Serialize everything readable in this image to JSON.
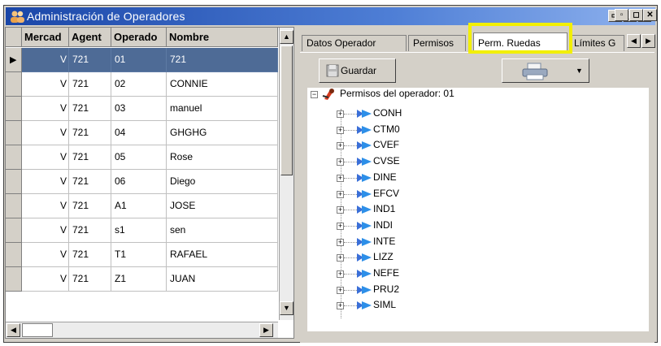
{
  "window": {
    "title": "Administración de Operadores"
  },
  "grid": {
    "columns": [
      "Mercad",
      "Agent",
      "Operado",
      "Nombre"
    ],
    "rows": [
      [
        "V",
        "721",
        "01",
        "721"
      ],
      [
        "V",
        "721",
        "02",
        "CONNIE"
      ],
      [
        "V",
        "721",
        "03",
        "manuel"
      ],
      [
        "V",
        "721",
        "04",
        "GHGHG"
      ],
      [
        "V",
        "721",
        "05",
        "Rose"
      ],
      [
        "V",
        "721",
        "06",
        "Diego"
      ],
      [
        "V",
        "721",
        "A1",
        "JOSE"
      ],
      [
        "V",
        "721",
        "s1",
        "sen"
      ],
      [
        "V",
        "721",
        "T1",
        "RAFAEL"
      ],
      [
        "V",
        "721",
        "Z1",
        "JUAN"
      ]
    ],
    "selected_row": 0
  },
  "tabs": [
    "Datos Operador",
    "Permisos",
    "Perm. Ruedas",
    "Límites G"
  ],
  "active_tab": "Perm. Ruedas",
  "toolbar": {
    "save_label": "Guardar"
  },
  "tree": {
    "root": "Permisos del operador: 01",
    "items": [
      "CONH",
      "CTM0",
      "CVEF",
      "CVSE",
      "DINE",
      "EFCV",
      "IND1",
      "INDI",
      "INTE",
      "LIZZ",
      "NEFE",
      "PRU2",
      "SIML"
    ]
  },
  "colors": {
    "selection": "#4e6b96",
    "highlight": "#f2ef00",
    "titlebar": "#1a46a8"
  }
}
